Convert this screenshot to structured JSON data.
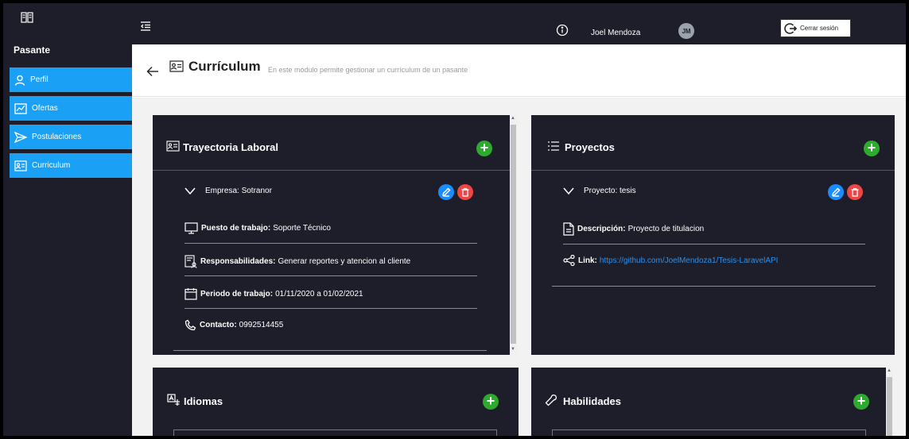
{
  "sidebar": {
    "title": "Pasante",
    "items": [
      {
        "label": "Perfil",
        "icon": "person-icon"
      },
      {
        "label": "Ofertas",
        "icon": "chart-icon"
      },
      {
        "label": "Postulaciones",
        "icon": "send-icon"
      },
      {
        "label": "Curriculum",
        "icon": "id-card-icon"
      }
    ]
  },
  "topbar": {
    "user_name": "Joel Mendoza",
    "avatar_initials": "JM",
    "logout_label": "Cerrar sesión"
  },
  "page": {
    "title": "Currículum",
    "subtitle": "En este módulo permite gestionar un currículum de un pasante"
  },
  "cards": {
    "trayectoria": {
      "title": "Trayectoria Laboral",
      "entry_label": "Empresa: Sotranor",
      "puesto_label": "Puesto de trabajo:",
      "puesto_value": "Soporte Técnico",
      "resp_label": "Responsabilidades:",
      "resp_value": "Generar reportes y atencion al cliente",
      "periodo_label": "Periodo de trabajo:",
      "periodo_value": "01/11/2020 a 01/02/2021",
      "contacto_label": "Contacto:",
      "contacto_value": "0992514455"
    },
    "proyectos": {
      "title": "Proyectos",
      "entry_label": "Proyecto: tesis",
      "desc_label": "Descripción:",
      "desc_value": "Proyecto de titulacion",
      "link_label": "Link:",
      "link_value": "https://github.com/JoelMendoza1/Tesis-LaravelAPI"
    },
    "idiomas": {
      "title": "Idiomas"
    },
    "habilidades": {
      "title": "Habilidades"
    }
  },
  "colors": {
    "dark": "#1e1e2a",
    "accent_blue": "#1aa0f5",
    "add_green": "#2eaa2e",
    "delete_red": "#f04545",
    "edit_blue": "#1a8cff"
  }
}
